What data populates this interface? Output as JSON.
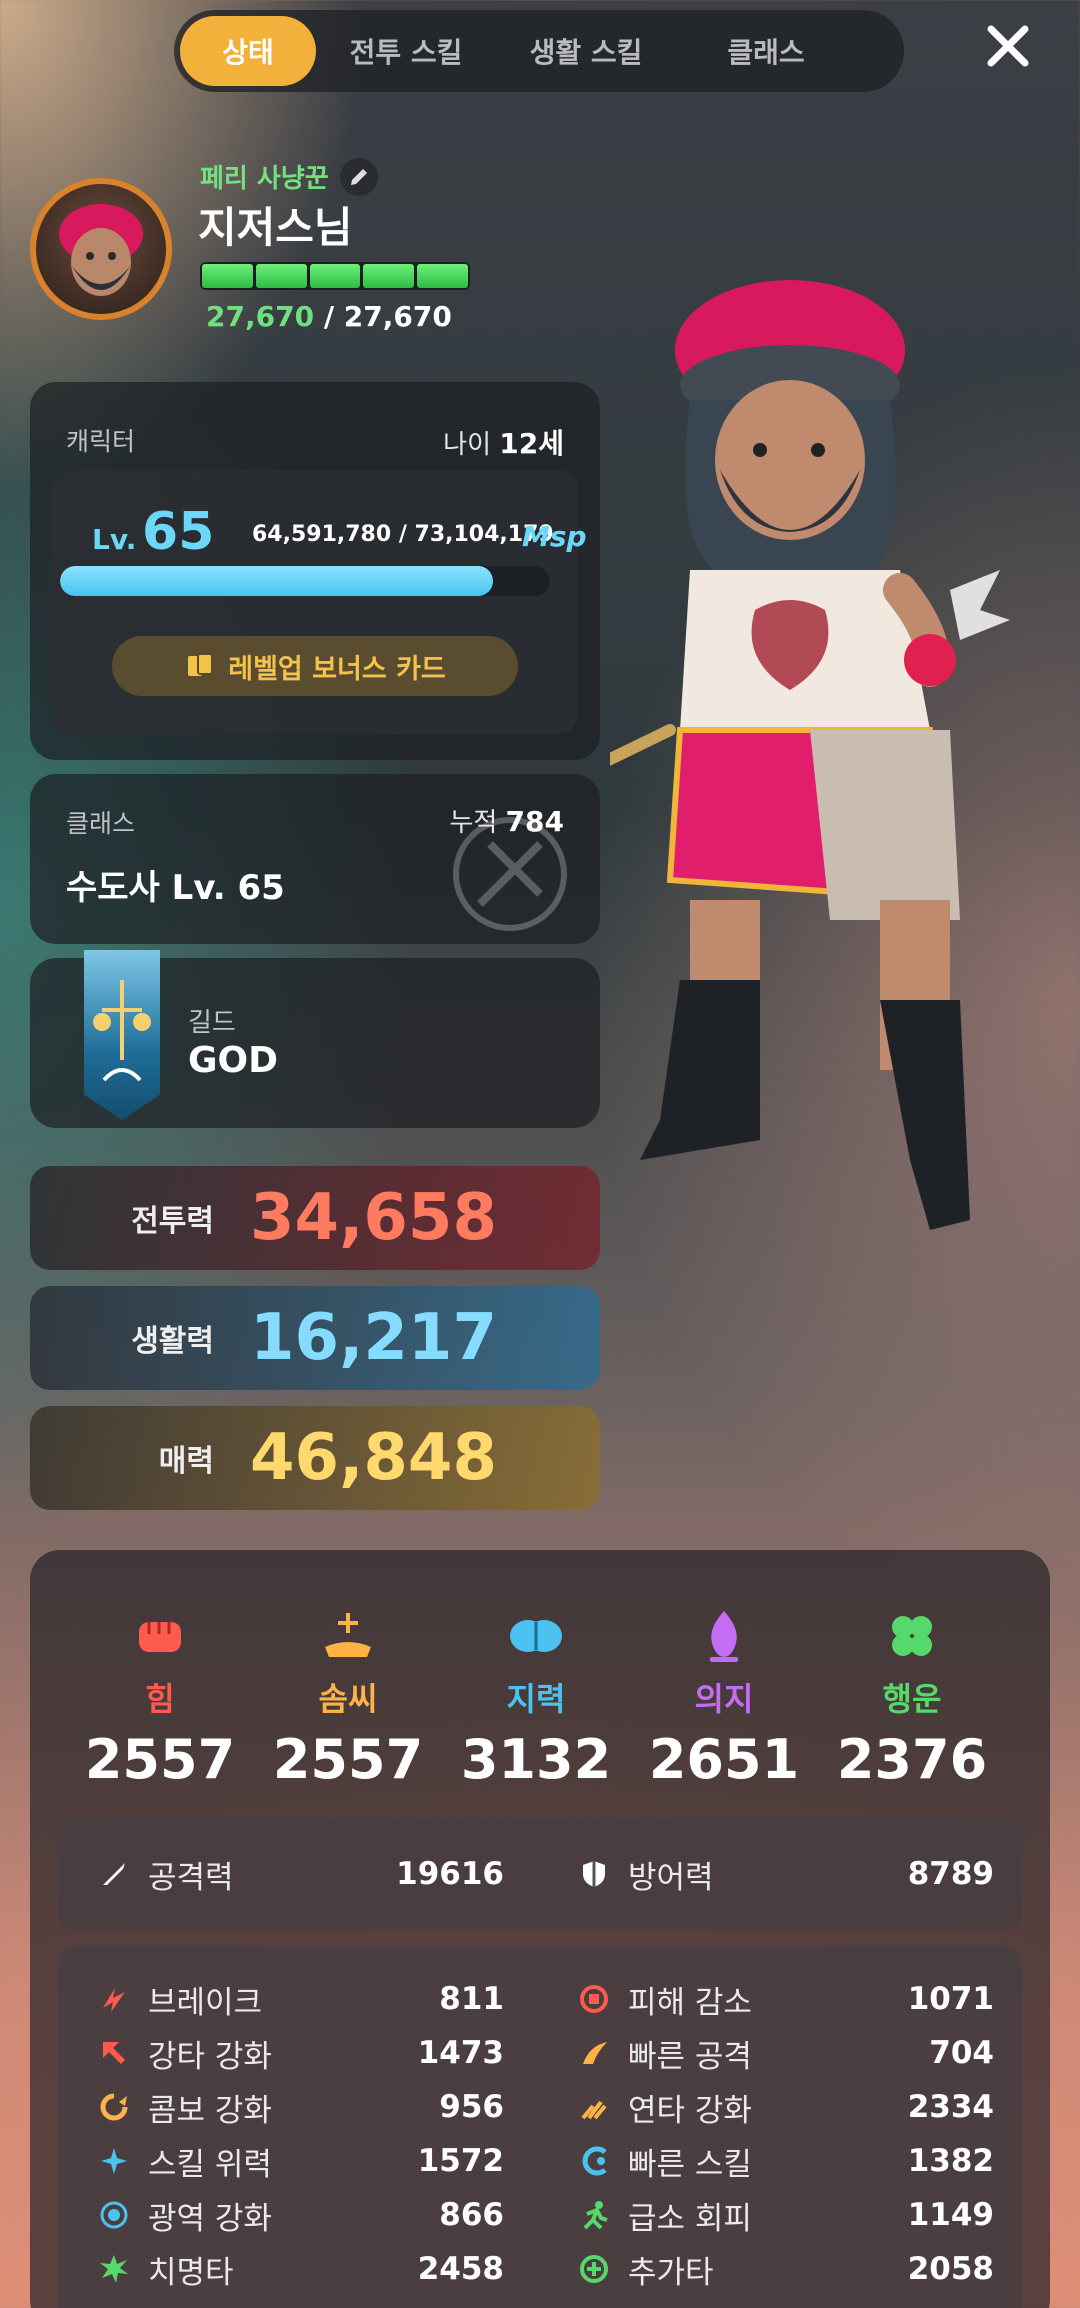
{
  "tabs": [
    "상태",
    "전투 스킬",
    "생활 스킬",
    "클래스"
  ],
  "profile": {
    "subtitle": "페리 사냥꾼",
    "name": "지저스님",
    "hp_current": "27,670",
    "hp_max": "/ 27,670",
    "hp_fraction": 1.0
  },
  "character": {
    "label": "캐릭터",
    "age_label": "나이",
    "age_value": "12세",
    "lv_word": "Lv.",
    "level": "65",
    "exp": "64,591,780 / 73,104,179",
    "msp": "Msp",
    "exp_fraction": 0.884,
    "bonus_button": "레벨업 보너스 카드"
  },
  "class": {
    "label": "클래스",
    "name": "수도사 Lv. 65",
    "cumul_label": "누적",
    "cumul_value": "784"
  },
  "guild": {
    "label": "길드",
    "name": "GOD"
  },
  "powers": [
    {
      "label": "전투력",
      "value": "34,658"
    },
    {
      "label": "생활력",
      "value": "16,217"
    },
    {
      "label": "매력",
      "value": "46,848"
    }
  ],
  "attributes": [
    {
      "name": "힘",
      "value": "2557",
      "color": "#ff5a4e",
      "icon": "fist-icon"
    },
    {
      "name": "솜씨",
      "value": "2557",
      "color": "#ffb347",
      "icon": "hand-sparkle-icon"
    },
    {
      "name": "지력",
      "value": "3132",
      "color": "#4cc2f0",
      "icon": "brain-icon"
    },
    {
      "name": "의지",
      "value": "2651",
      "color": "#c46cf5",
      "icon": "flame-icon"
    },
    {
      "name": "행운",
      "value": "2376",
      "color": "#55d96a",
      "icon": "clover-icon"
    }
  ],
  "main_stats": [
    {
      "name": "공격력",
      "value": "19616",
      "icon": "sword-icon"
    },
    {
      "name": "방어력",
      "value": "8789",
      "icon": "shield-icon"
    }
  ],
  "sub_stats_left": [
    {
      "name": "브레이크",
      "value": "811",
      "color": "#ff5a4e"
    },
    {
      "name": "강타 강화",
      "value": "1473",
      "color": "#ff5a4e"
    },
    {
      "name": "콤보 강화",
      "value": "956",
      "color": "#ffb347"
    },
    {
      "name": "스킬 위력",
      "value": "1572",
      "color": "#4cc2f0"
    },
    {
      "name": "광역 강화",
      "value": "866",
      "color": "#4cc2f0"
    },
    {
      "name": "치명타",
      "value": "2458",
      "color": "#55d96a"
    }
  ],
  "sub_stats_right": [
    {
      "name": "피해 감소",
      "value": "1071",
      "color": "#ff5a4e"
    },
    {
      "name": "빠른 공격",
      "value": "704",
      "color": "#ffb347"
    },
    {
      "name": "연타 강화",
      "value": "2334",
      "color": "#ffb347"
    },
    {
      "name": "빠른 스킬",
      "value": "1382",
      "color": "#4cc2f0"
    },
    {
      "name": "급소 회피",
      "value": "1149",
      "color": "#55d96a"
    },
    {
      "name": "추가타",
      "value": "2058",
      "color": "#55d96a"
    }
  ]
}
